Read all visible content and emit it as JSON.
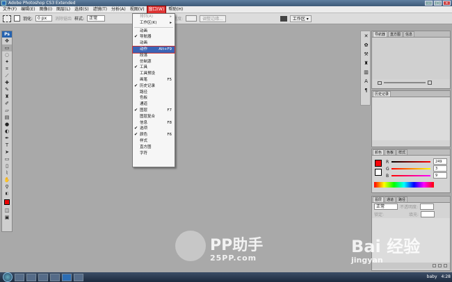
{
  "window": {
    "title": "Adobe Photoshop CS3 Extended"
  },
  "menubar": {
    "items": [
      "文件(F)",
      "编辑(E)",
      "图像(I)",
      "图层(L)",
      "选择(S)",
      "滤镜(T)",
      "分析(A)",
      "视图(V)",
      "窗口(W)",
      "帮助(H)"
    ],
    "active_index": 8
  },
  "options_bar": {
    "feather_label": "羽化:",
    "feather_value": "0 px",
    "antialias_label": "消除锯齿",
    "style_label": "样式:",
    "style_value": "正常",
    "width_label": "宽度:",
    "refine_label": "调整边缘...",
    "workspace_label": "工作区 ▾"
  },
  "window_menu": {
    "items": [
      {
        "label": "排列(A)",
        "check": false,
        "shortcut": "",
        "submenu": true,
        "gray": true
      },
      {
        "label": "工作区(K)",
        "check": false,
        "shortcut": "",
        "submenu": true
      },
      {
        "label": "动画",
        "check": false,
        "shortcut": "",
        "sep_before": true
      },
      {
        "label": "导航器",
        "check": true,
        "shortcut": ""
      },
      {
        "label": "动画",
        "check": false,
        "shortcut": ""
      },
      {
        "label": "动作",
        "check": false,
        "shortcut": "Alt+F9",
        "highlight": true
      },
      {
        "label": "段落",
        "check": false,
        "shortcut": ""
      },
      {
        "label": "仿制源",
        "check": false,
        "shortcut": ""
      },
      {
        "label": "工具",
        "check": true,
        "shortcut": ""
      },
      {
        "label": "工具预设",
        "check": false,
        "shortcut": ""
      },
      {
        "label": "画笔",
        "check": false,
        "shortcut": "F5"
      },
      {
        "label": "历史记录",
        "check": true,
        "shortcut": ""
      },
      {
        "label": "路径",
        "check": false,
        "shortcut": ""
      },
      {
        "label": "色板",
        "check": false,
        "shortcut": ""
      },
      {
        "label": "通道",
        "check": false,
        "shortcut": ""
      },
      {
        "label": "图层",
        "check": true,
        "shortcut": "F7"
      },
      {
        "label": "图层复合",
        "check": false,
        "shortcut": ""
      },
      {
        "label": "信息",
        "check": false,
        "shortcut": "F8"
      },
      {
        "label": "选项",
        "check": true,
        "shortcut": ""
      },
      {
        "label": "颜色",
        "check": true,
        "shortcut": "F6"
      },
      {
        "label": "样式",
        "check": false,
        "shortcut": ""
      },
      {
        "label": "直方图",
        "check": false,
        "shortcut": ""
      },
      {
        "label": "字符",
        "check": false,
        "shortcut": ""
      }
    ]
  },
  "panels": {
    "navigator_tabs": [
      "导航器",
      "直方图",
      "信息"
    ],
    "history_tab": "历史记录",
    "color_tabs": [
      "颜色",
      "色板",
      "样式"
    ],
    "color": {
      "r_label": "R",
      "r": "249",
      "g_label": "G",
      "g": "3",
      "b_label": "B",
      "b": "9",
      "fg_color": "#f90309"
    },
    "layers_tabs": [
      "图层",
      "通道",
      "路径"
    ],
    "layers": {
      "blend": "正常",
      "opacity_label": "不透明度:",
      "lock_label": "锁定:",
      "fill_label": "填充:"
    }
  },
  "watermarks": {
    "left": "PP助手",
    "left_sub": "25PP.com",
    "right": "Bai 经验",
    "right_sub": "jingyan"
  },
  "taskbar": {
    "tray_user": "baby",
    "tray_time": "4:28"
  }
}
